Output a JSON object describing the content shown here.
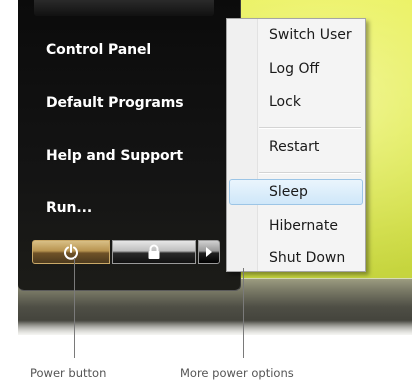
{
  "start_menu": {
    "items": [
      {
        "label": "Control Panel"
      },
      {
        "label": "Default Programs"
      },
      {
        "label": "Help and Support"
      },
      {
        "label": "Run..."
      }
    ]
  },
  "power_buttons": {
    "power_icon": "power-icon",
    "lock_icon": "padlock-icon",
    "more_icon": "arrow-right-icon"
  },
  "power_submenu": {
    "items": [
      {
        "label": "Switch User"
      },
      {
        "label": "Log Off"
      },
      {
        "label": "Lock"
      },
      {
        "label": "Restart"
      },
      {
        "label": "Sleep",
        "highlighted": true
      },
      {
        "label": "Hibernate"
      },
      {
        "label": "Shut Down"
      }
    ]
  },
  "callouts": {
    "power_button": "Power button",
    "more_options": "More power options"
  },
  "colors": {
    "desktop": "#d9e63a",
    "menu_bg": "#0b0b0b",
    "power_button": "#b89450",
    "highlight": "#cfe7f9"
  }
}
